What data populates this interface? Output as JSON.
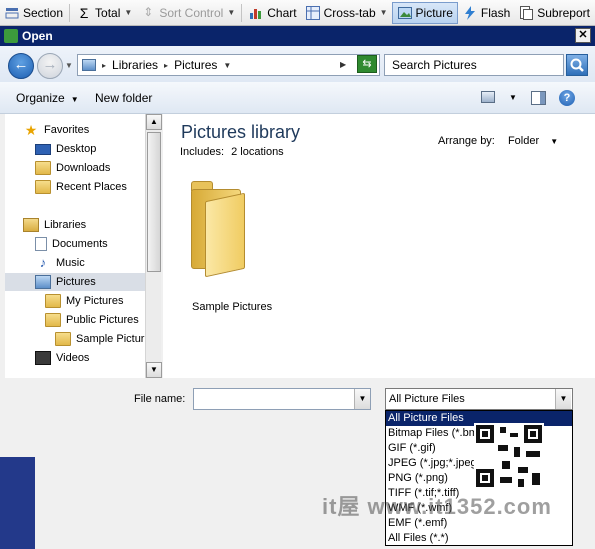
{
  "toolbar": {
    "items": [
      {
        "label": "Section",
        "icon": "section-icon",
        "state": "normal"
      },
      {
        "label": "Total",
        "icon": "sigma-icon",
        "state": "normal"
      },
      {
        "label": "Sort Control",
        "icon": "sort-icon",
        "state": "disabled"
      },
      {
        "label": "Chart",
        "icon": "chart-icon",
        "state": "normal"
      },
      {
        "label": "Cross-tab",
        "icon": "crosstab-icon",
        "state": "normal"
      },
      {
        "label": "Picture",
        "icon": "picture-icon",
        "state": "active"
      },
      {
        "label": "Flash",
        "icon": "flash-icon",
        "state": "normal"
      },
      {
        "label": "Subreport",
        "icon": "subreport-icon",
        "state": "normal"
      }
    ]
  },
  "dialog": {
    "title": "Open",
    "close_glyph": "✕",
    "address": {
      "crumbs": [
        "Libraries",
        "Pictures"
      ]
    },
    "search_placeholder": "Search Pictures",
    "commands": {
      "organize": "Organize",
      "new_folder": "New folder",
      "help": "?"
    },
    "nav": {
      "favorites_header": "Favorites",
      "favorites": [
        "Desktop",
        "Downloads",
        "Recent Places"
      ],
      "libraries_header": "Libraries",
      "libraries": [
        "Documents",
        "Music",
        "Pictures"
      ],
      "pictures_children": [
        "My Pictures",
        "Public Pictures"
      ],
      "public_children": [
        "Sample Pictures"
      ],
      "after": [
        "Videos"
      ],
      "selected": "Pictures"
    },
    "content": {
      "title": "Pictures library",
      "includes_label": "Includes:",
      "includes_value": "2 locations",
      "arrange_label": "Arrange by:",
      "arrange_value": "Folder",
      "folder_name": "Sample Pictures"
    },
    "file_name_label": "File name:",
    "file_name_value": "",
    "file_type_selected": "All Picture Files",
    "file_type_options": [
      "All Picture Files",
      "Bitmap Files (*.bmp)",
      "GIF (*.gif)",
      "JPEG (*.jpg;*.jpeg)",
      "PNG (*.png)",
      "TIFF (*.tif;*.tiff)",
      "WMF (*.wmf)",
      "EMF (*.emf)",
      "All Files (*.*)"
    ]
  },
  "watermark": "it屋 www.it1352.com",
  "colors": {
    "title_bar": "#0a246a",
    "selection": "#0a246a",
    "accent": "#1e395b"
  }
}
